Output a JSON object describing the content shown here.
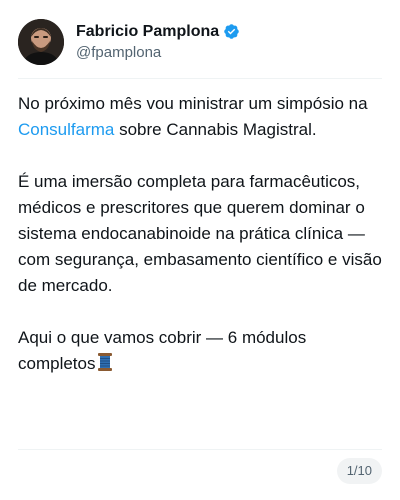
{
  "author": {
    "display_name": "Fabricio Pamplona",
    "handle": "@fpamplona",
    "verified_icon": "verified-badge-icon",
    "avatar_icon": "avatar-photo"
  },
  "post": {
    "p1_text_before": "No próximo mês vou ministrar um simpósio na ",
    "p1_link": "Consulfarma",
    "p1_text_after": " sobre Cannabis Magistral.",
    "p2": "É uma imersão completa para farmacêuticos, médicos e prescritores que querem dominar o sistema endocanabinoide na prática clínica — com segurança, embasamento científico e visão de mercado.",
    "p3": "Aqui o que vamos cobrir — 6 módulos completos",
    "p3_emoji": "thread-spool-icon"
  },
  "pager": {
    "label": "1/10"
  },
  "colors": {
    "link": "#1d9bf0",
    "verified": "#1d9bf0",
    "text": "#0f1419",
    "secondary": "#536471"
  }
}
